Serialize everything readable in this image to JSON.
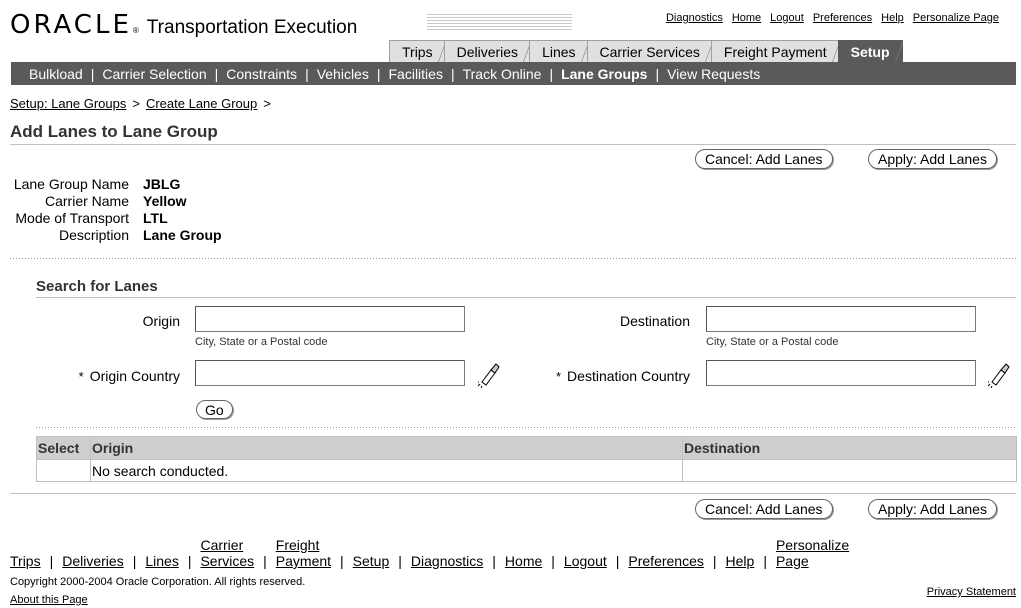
{
  "header": {
    "brand_oracle": "ORACLE",
    "brand_reg": "®",
    "brand_app": "Transportation Execution",
    "global_links": [
      "Diagnostics",
      "Home",
      "Logout",
      "Preferences",
      "Help",
      "Personalize Page"
    ]
  },
  "tabs": [
    "Trips",
    "Deliveries",
    "Lines",
    "Carrier Services",
    "Freight Payment",
    "Setup"
  ],
  "active_tab": "Setup",
  "subtabs": [
    "Bulkload",
    "Carrier Selection",
    "Constraints",
    "Vehicles",
    "Facilities",
    "Track Online",
    "Lane Groups",
    "View Requests"
  ],
  "active_subtab": "Lane Groups",
  "breadcrumb": {
    "items": [
      "Setup: Lane Groups",
      "Create Lane Group"
    ],
    "separator": ">"
  },
  "page_title": "Add Lanes to Lane Group",
  "buttons": {
    "cancel": "Cancel: Add Lanes",
    "apply": "Apply: Add Lanes",
    "go": "Go"
  },
  "info": {
    "lane_group_name_label": "Lane Group Name",
    "lane_group_name": "JBLG",
    "carrier_name_label": "Carrier Name",
    "carrier_name": "Yellow",
    "mode_label": "Mode of Transport",
    "mode": "LTL",
    "description_label": "Description",
    "description": "Lane Group"
  },
  "search": {
    "title": "Search for Lanes",
    "origin_label": "Origin",
    "origin_value": "",
    "origin_hint": "City, State or a Postal code",
    "destination_label": "Destination",
    "destination_value": "",
    "destination_hint": "City, State or a Postal code",
    "required_marker": "*",
    "origin_country_label": "Origin Country",
    "origin_country_value": "",
    "destination_country_label": "Destination Country",
    "destination_country_value": ""
  },
  "results": {
    "columns": [
      "Select",
      "Origin",
      "Destination"
    ],
    "empty_message": "No search conducted."
  },
  "footer": {
    "links": [
      "Trips",
      "Deliveries",
      "Lines",
      "Carrier|Services",
      "Freight|Payment",
      "Setup",
      "Diagnostics",
      "Home",
      "Logout",
      "Preferences",
      "Help",
      "Personalize|Page"
    ],
    "carrier_1": "Carrier",
    "carrier_2": "Services",
    "freight_1": "Freight",
    "freight_2": "Payment",
    "personalize_1": "Personalize",
    "personalize_2": "Page",
    "copyright": "Copyright 2000-2004 Oracle Corporation. All rights reserved.",
    "about": "About this Page",
    "privacy": "Privacy Statement"
  },
  "icons": {
    "search_flashlight": "flashlight-icon"
  },
  "colors": {
    "tab_active_bg": "#5a5a5a",
    "subtab_bg": "#5a5a5a",
    "table_header_bg": "#cfcfcf"
  }
}
